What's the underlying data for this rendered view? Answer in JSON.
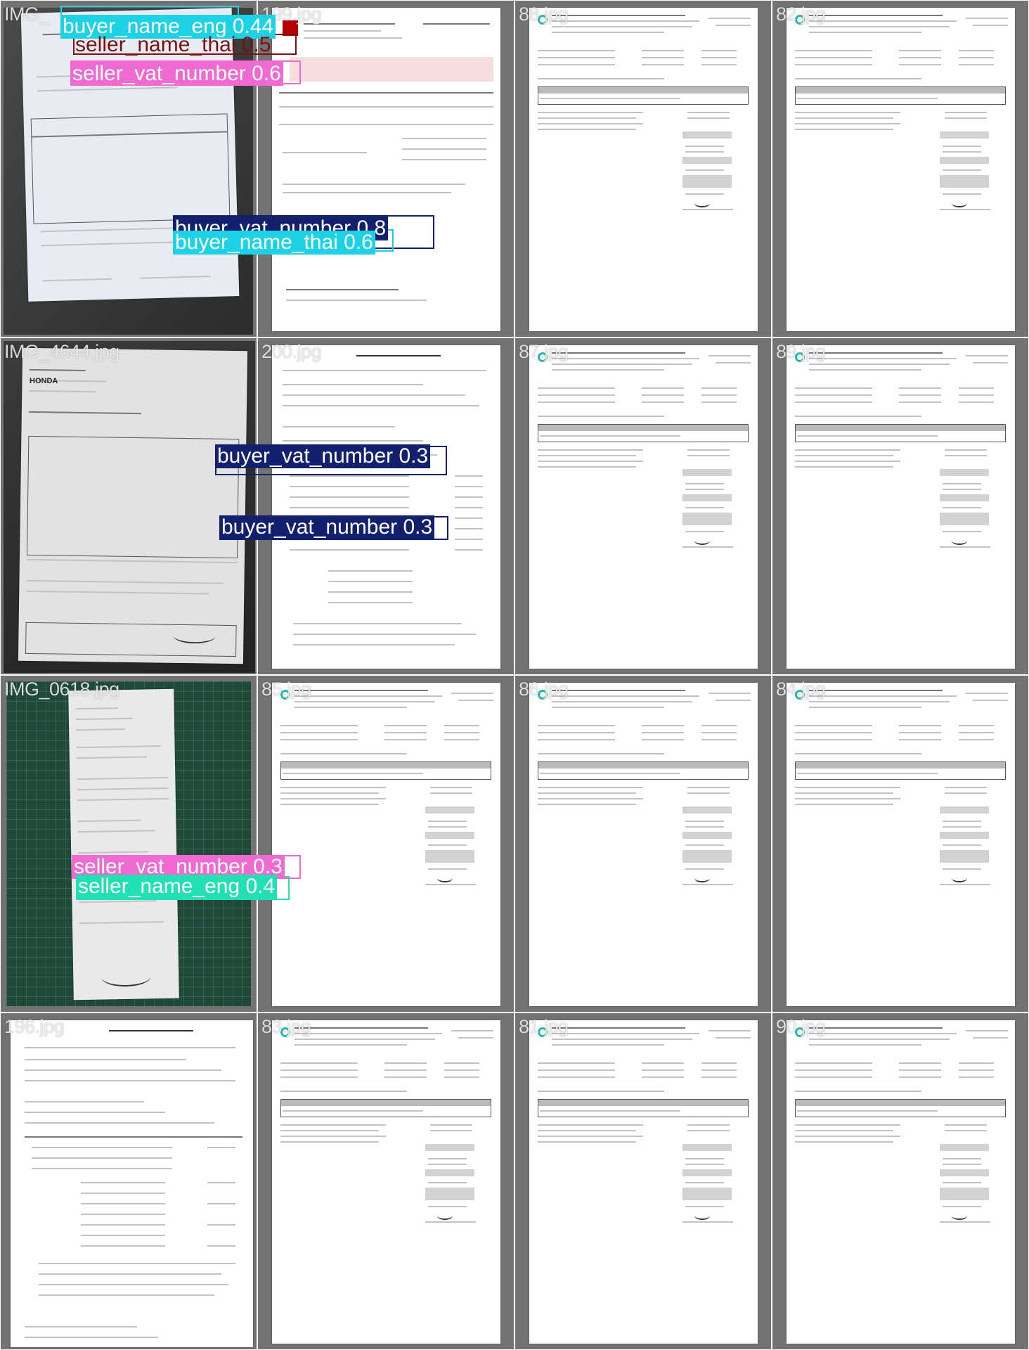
{
  "grid": {
    "cells": [
      {
        "id": 0,
        "filename": "IMG_",
        "kind": "photo-invoice"
      },
      {
        "id": 1,
        "filename": "199.jpg",
        "kind": "scan-invoice"
      },
      {
        "id": 2,
        "filename": "88.jpg",
        "kind": "form"
      },
      {
        "id": 3,
        "filename": "82.jpg",
        "kind": "form"
      },
      {
        "id": 4,
        "filename": "IMG_4644.jpg",
        "kind": "photo-receipt"
      },
      {
        "id": 5,
        "filename": "200.jpg",
        "kind": "text-invoice"
      },
      {
        "id": 6,
        "filename": "87.jpg",
        "kind": "form"
      },
      {
        "id": 7,
        "filename": "89.jpg",
        "kind": "form"
      },
      {
        "id": 8,
        "filename": "IMG_0618.jpg",
        "kind": "slip"
      },
      {
        "id": 9,
        "filename": "85.jpg",
        "kind": "form"
      },
      {
        "id": 10,
        "filename": "86.jpg",
        "kind": "form"
      },
      {
        "id": 11,
        "filename": "84.jpg",
        "kind": "form"
      },
      {
        "id": 12,
        "filename": "196.jpg",
        "kind": "text-invoice"
      },
      {
        "id": 13,
        "filename": "83.jpg",
        "kind": "form"
      },
      {
        "id": 14,
        "filename": "81.jpg",
        "kind": "form"
      },
      {
        "id": 15,
        "filename": "90.jpg",
        "kind": "form"
      }
    ]
  },
  "detections": [
    {
      "label": "buyer_name_eng 0.44",
      "class": "buyer_name_eng",
      "color": "#1ed2e6",
      "text_color": "#ffffff"
    },
    {
      "label": "seller_name_thai 0.5",
      "class": "seller_name_thai",
      "color": "#7a1010",
      "text_color": "#7a1010"
    },
    {
      "label": "seller_vat_number 0.6",
      "class": "seller_vat_number",
      "color": "#f06ad2",
      "text_color": "#ffffff"
    },
    {
      "label": "buyer_vat_number 0.8",
      "class": "buyer_vat_number",
      "color": "#12206e",
      "text_color": "#ffffff"
    },
    {
      "label": "buyer_name_thai 0.6",
      "class": "buyer_name_thai",
      "color": "#1ed2e6",
      "text_color": "#ffffff"
    },
    {
      "label": "buyer_vat_number 0.3",
      "class": "buyer_vat_number",
      "color": "#12206e",
      "text_color": "#ffffff"
    },
    {
      "label": "buyer_vat_number 0.3",
      "class": "buyer_vat_number",
      "color": "#12206e",
      "text_color": "#ffffff"
    },
    {
      "label": "seller_vat_number 0.3",
      "class": "seller_vat_number",
      "color": "#f06ad2",
      "text_color": "#ffffff"
    },
    {
      "label": "seller_name_eng 0.4",
      "class": "seller_name_eng",
      "color": "#20e0b4",
      "text_color": "#ffffff"
    }
  ],
  "page_text": {
    "honda_brand": "HONDA"
  }
}
